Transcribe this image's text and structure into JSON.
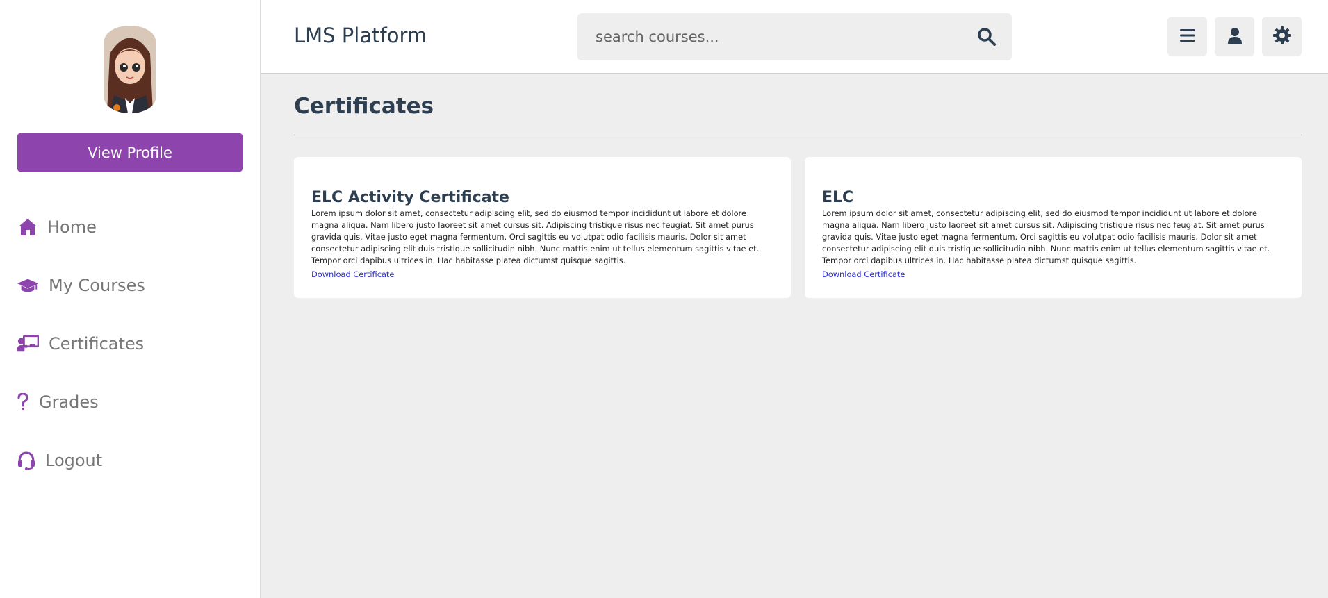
{
  "app": {
    "brand": "LMS Platform"
  },
  "sidebar": {
    "view_profile_label": "View Profile",
    "items": [
      {
        "label": "Home",
        "icon": "home-icon"
      },
      {
        "label": "My Courses",
        "icon": "graduation-cap-icon"
      },
      {
        "label": "Certificates",
        "icon": "chalkboard-teacher-icon"
      },
      {
        "label": "Grades",
        "icon": "question-icon"
      },
      {
        "label": "Logout",
        "icon": "headset-icon"
      }
    ]
  },
  "header": {
    "search_placeholder": "search courses...",
    "buttons": [
      "menu-icon",
      "user-icon",
      "gear-icon"
    ]
  },
  "page": {
    "title": "Certificates",
    "cards": [
      {
        "title": "ELC Activity Certificate",
        "text": "Lorem ipsum dolor sit amet, consectetur adipiscing elit, sed do eiusmod tempor incididunt ut labore et dolore magna aliqua. Nam libero justo laoreet sit amet cursus sit. Adipiscing tristique risus nec feugiat. Sit amet purus gravida quis. Vitae justo eget magna fermentum. Orci sagittis eu volutpat odio facilisis mauris. Dolor sit amet consectetur adipiscing elit duis tristique sollicitudin nibh. Nunc mattis enim ut tellus elementum sagittis vitae et. Tempor orci dapibus ultrices in. Hac habitasse platea dictumst quisque sagittis.",
        "link": "Download Certificate"
      },
      {
        "title": "ELC",
        "text": "Lorem ipsum dolor sit amet, consectetur adipiscing elit, sed do eiusmod tempor incididunt ut labore et dolore magna aliqua. Nam libero justo laoreet sit amet cursus sit. Adipiscing tristique risus nec feugiat. Sit amet purus gravida quis. Vitae justo eget magna fermentum. Orci sagittis eu volutpat odio facilisis mauris. Dolor sit amet consectetur adipiscing elit duis tristique sollicitudin nibh. Nunc mattis enim ut tellus elementum sagittis vitae et. Tempor orci dapibus ultrices in. Hac habitasse platea dictumst quisque sagittis.",
        "link": "Download Certificate"
      }
    ]
  },
  "colors": {
    "accent": "#8e44ad",
    "text_dark": "#2c3e50",
    "link": "#3030d0",
    "background": "#eeeeee"
  }
}
